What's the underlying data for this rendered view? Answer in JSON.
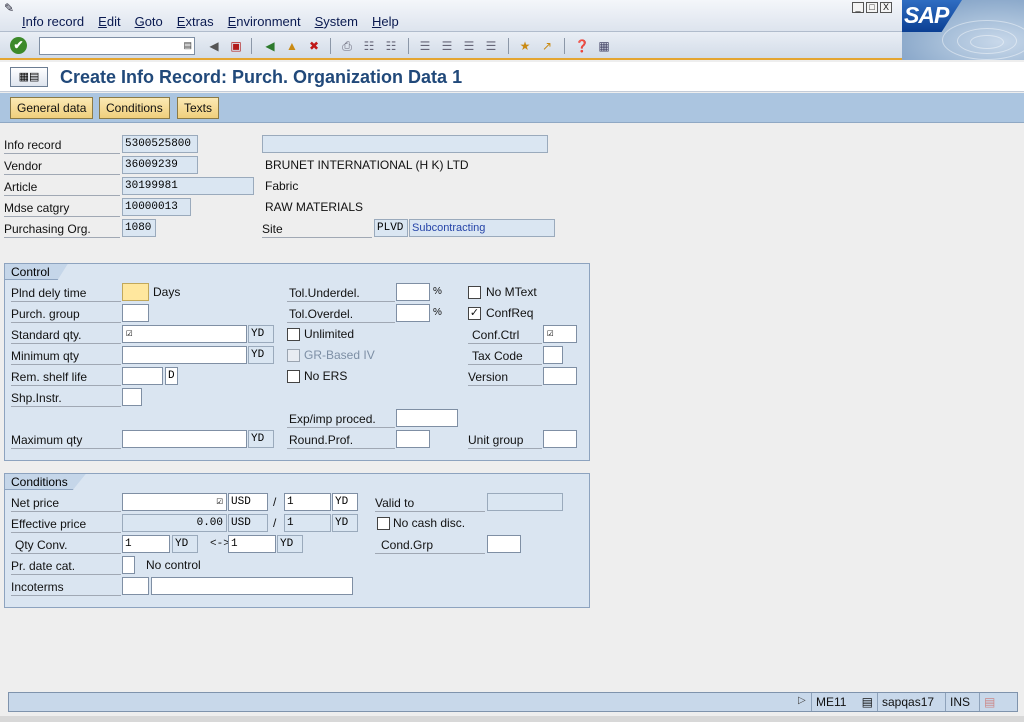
{
  "menu": [
    "Info record",
    "Edit",
    "Goto",
    "Extras",
    "Environment",
    "System",
    "Help"
  ],
  "window_controls": [
    "_",
    "□",
    "X"
  ],
  "logo_text": "SAP",
  "title": "Create Info Record: Purch. Organization Data 1",
  "app_buttons": [
    "General data",
    "Conditions",
    "Texts"
  ],
  "header": {
    "info_record_label": "Info record",
    "info_record_value": "5300525800",
    "vendor_label": "Vendor",
    "vendor_value": "36009239",
    "vendor_name": "BRUNET INTERNATIONAL (H K) LTD",
    "article_label": "Article",
    "article_value": "30199981",
    "article_desc": "Fabric",
    "mdse_label": "Mdse catgry",
    "mdse_value": "10000013",
    "mdse_desc": "RAW MATERIALS",
    "porg_label": "Purchasing Org.",
    "porg_value": "1080",
    "site_label": "Site",
    "site_value": "PLVD",
    "site_desc": "Subcontracting"
  },
  "control": {
    "title": "Control",
    "plnd_label": "Plnd dely time",
    "plnd_unit": "Days",
    "purch_group_label": "Purch. group",
    "std_qty_label": "Standard qty.",
    "std_qty_unit": "YD",
    "min_qty_label": "Minimum qty",
    "min_qty_unit": "YD",
    "shelf_label": "Rem. shelf life",
    "shelf_unit": "D",
    "shp_label": "Shp.Instr.",
    "max_qty_label": "Maximum qty",
    "max_qty_unit": "YD",
    "tol_under_label": "Tol.Underdel.",
    "tol_under_unit": "%",
    "tol_over_label": "Tol.Overdel.",
    "tol_over_unit": "%",
    "unlimited_label": "Unlimited",
    "gr_iv_label": "GR-Based IV",
    "no_ers_label": "No ERS",
    "exp_label": "Exp/imp proced.",
    "round_label": "Round.Prof.",
    "no_mtext_label": "No MText",
    "confreq_label": "ConfReq",
    "conf_ctrl_label": "Conf.Ctrl",
    "tax_label": "Tax Code",
    "version_label": "Version",
    "unit_group_label": "Unit group"
  },
  "conditions": {
    "title": "Conditions",
    "net_price_label": "Net price",
    "net_currency": "USD",
    "net_per": "1",
    "net_unit": "YD",
    "eff_price_label": "Effective price",
    "eff_value": "0.00",
    "eff_currency": "USD",
    "eff_per": "1",
    "eff_unit": "YD",
    "qty_conv_label": "Qty Conv.",
    "qty_conv_left": "1",
    "qty_conv_left_unit": "YD",
    "qty_conv_arrow": "<->",
    "qty_conv_right": "1",
    "qty_conv_right_unit": "YD",
    "pr_date_label": "Pr. date cat.",
    "pr_date_desc": "No control",
    "incoterms_label": "Incoterms",
    "valid_to_label": "Valid to",
    "no_cash_label": "No cash disc.",
    "cond_grp_label": "Cond.Grp",
    "slash": "/"
  },
  "status": {
    "transaction": "ME11",
    "system": "sapqas17",
    "mode": "INS"
  },
  "colors": {
    "accent": "#e4a531",
    "title": "#21497a",
    "group_bg": "#dae5f1"
  }
}
